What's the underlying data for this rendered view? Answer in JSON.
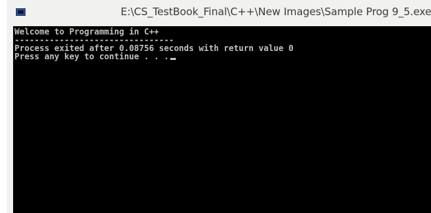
{
  "window": {
    "title": "E:\\CS_TestBook_Final\\C++\\New Images\\Sample Prog 9_5.exe",
    "icon": "console-app-icon"
  },
  "console": {
    "lines": [
      "Welcome to Programming in C++",
      "--------------------------------",
      "Process exited after 0.08756 seconds with return value 0",
      "Press any key to continue . . ."
    ]
  }
}
